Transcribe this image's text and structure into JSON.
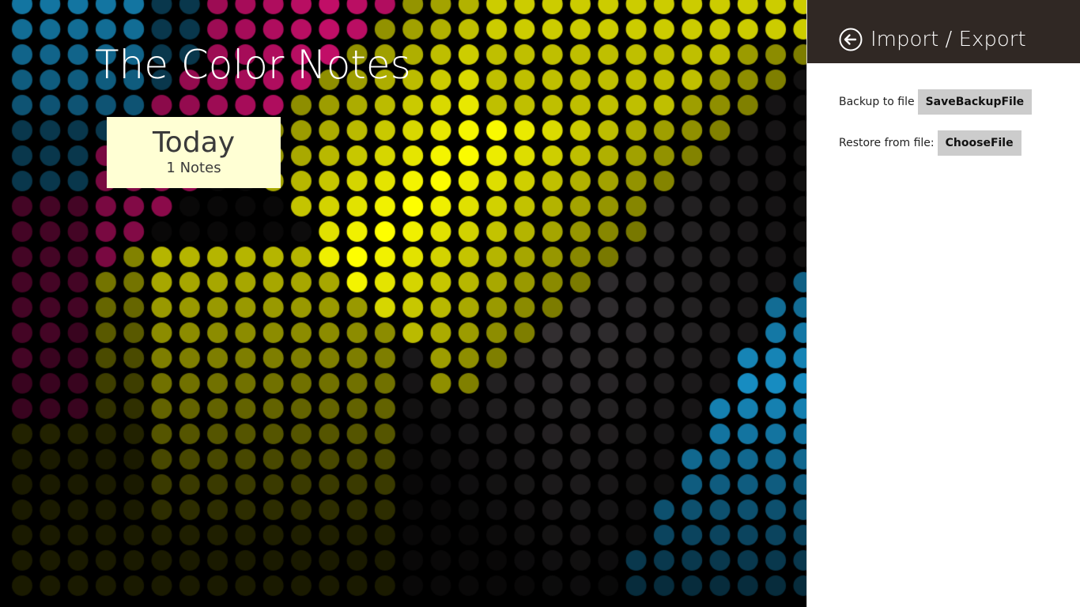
{
  "app": {
    "title": "The Color Notes",
    "background_palette": {
      "magenta": "#e4117a",
      "yellow": "#ffff00",
      "cyan": "#1a9ed9",
      "gray": "#3a3638"
    }
  },
  "groups": [
    {
      "title": "Today",
      "count_label": "1 Notes",
      "color": "#ffffd4"
    }
  ],
  "settings_pane": {
    "title": "Import / Export",
    "back_icon": "back-arrow-circle-icon",
    "header_color": "#302824",
    "backup": {
      "label": "Backup to file",
      "button_label": "SaveBackupFile"
    },
    "restore": {
      "label": "Restore from file:",
      "button_label": "ChooseFile"
    }
  }
}
